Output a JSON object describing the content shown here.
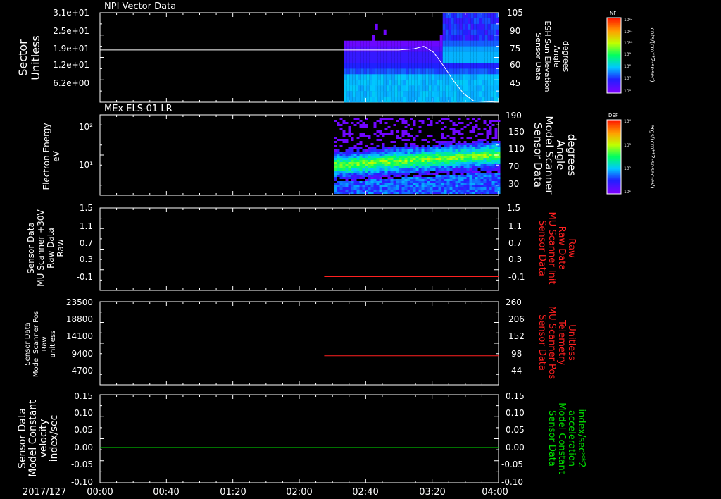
{
  "date_label": "2017/127",
  "time_ticks": [
    "00:00",
    "00:40",
    "01:20",
    "02:00",
    "02:40",
    "03:20",
    "04:00"
  ],
  "panels": [
    {
      "id": "npi",
      "title": "NPI Vector Data",
      "left_label": [
        "Sector",
        "Unitless"
      ],
      "left_ticks": [
        "3.1e+01",
        "2.5e+01",
        "1.9e+01",
        "1.2e+01",
        "6.2e+00"
      ],
      "right_label": [
        "Sensor Data",
        "ESH Sun Elevation",
        "Angle",
        "degrees"
      ],
      "right_ticks": [
        "105",
        "90",
        "75",
        "60",
        "45"
      ],
      "colorbar": {
        "tag": "NF",
        "unit": "cnts/(cm**2-sr-sec)",
        "ticks": [
          "10¹²",
          "10¹¹",
          "10¹⁰",
          "10⁹",
          "10⁸",
          "10⁷",
          "10⁶"
        ]
      }
    },
    {
      "id": "els",
      "title": "MEx ELS-01 LR",
      "left_label": [
        "Electron Energy",
        "eV"
      ],
      "left_ticks": [
        "10²",
        "10¹"
      ],
      "right_label": [
        "Sensor Data",
        "Model Scanner",
        "Angle",
        "degrees"
      ],
      "right_ticks": [
        "190",
        "150",
        "110",
        "70",
        "30"
      ],
      "colorbar": {
        "tag": "DEF",
        "unit": "ergs/(cm**2-sr-sec-eV)",
        "ticks": [
          "10⁴",
          "10³",
          "10²",
          "10¹"
        ]
      }
    },
    {
      "id": "mu30",
      "left_label": [
        "Sensor Data",
        "MU Scanner +30V",
        "Raw Data",
        "Raw"
      ],
      "left_ticks": [
        "1.5",
        "1.1",
        "0.7",
        "0.3",
        "-0.1"
      ],
      "right_label": [
        "Sensor Data",
        "MU Scanner Init",
        "Raw Data",
        "Raw"
      ],
      "right_ticks": [
        "1.5",
        "1.1",
        "0.7",
        "0.3",
        "-0.1"
      ]
    },
    {
      "id": "pos",
      "left_label": [
        "Sensor Data",
        "Model Scanner Pos",
        "Raw",
        "unitless"
      ],
      "left_ticks": [
        "23500",
        "18800",
        "14100",
        "9400",
        "4700"
      ],
      "right_label": [
        "Sensor Data",
        "MU Scanner Pos",
        "Telemetry",
        "Unitless"
      ],
      "right_ticks": [
        "260",
        "206",
        "152",
        "98",
        "44"
      ]
    },
    {
      "id": "model",
      "left_label": [
        "Sensor Data",
        "Model Constant",
        "velocity",
        "index/sec"
      ],
      "left_ticks": [
        "0.15",
        "0.10",
        "0.05",
        "0.00",
        "-0.05",
        "-0.10"
      ],
      "right_label": [
        "Sensor Data",
        "Model Constant",
        "acceleration",
        "index/sec**2"
      ],
      "right_ticks": [
        "0.15",
        "0.10",
        "0.05",
        "0.00",
        "-0.05",
        "-0.10"
      ]
    }
  ],
  "colors": {
    "white": "#ffffff",
    "red": "#ff2020",
    "green": "#00e000"
  },
  "chart_data": [
    {
      "type": "heatmap",
      "title": "NPI Vector Data",
      "x_range_hours": [
        0,
        4
      ],
      "ylabel": "Sector Unitless",
      "y2label": "Sensor Data ESH Sun Elevation Angle degrees",
      "data_start_hour": 2.45,
      "overlay_line": {
        "name": "ESH Sun Elevation Angle",
        "x": [
          0.0,
          2.45,
          3.0,
          3.15,
          3.25,
          3.35,
          3.45,
          3.55,
          3.65,
          3.75,
          4.0
        ],
        "y": [
          75,
          75,
          75,
          76,
          78,
          73,
          62,
          50,
          40,
          34,
          33
        ]
      }
    },
    {
      "type": "heatmap",
      "title": "MEx ELS-01 LR",
      "x_range_hours": [
        0,
        4
      ],
      "ylabel": "Electron Energy eV",
      "y2label": "Sensor Data Model Scanner Angle degrees",
      "data_start_hour": 2.35,
      "overlay_line": {
        "name": "Model Scanner Angle",
        "x": [
          0,
          4
        ],
        "y": [
          10,
          10
        ]
      }
    },
    {
      "type": "line",
      "x_range_hours": [
        0,
        4
      ],
      "ylim": [
        -0.3,
        1.5
      ],
      "series": [
        {
          "name": "MU Scanner Init Raw Data",
          "color": "#ff2020",
          "x": [
            2.25,
            4.0
          ],
          "y": [
            0.0,
            0.0
          ]
        }
      ]
    },
    {
      "type": "line",
      "x_range_hours": [
        0,
        4
      ],
      "ylim": [
        0,
        23500
      ],
      "series": [
        {
          "name": "MU Scanner Pos Telemetry",
          "color": "#ff2020",
          "x": [
            2.25,
            4.0
          ],
          "y": [
            8200,
            8200
          ]
        }
      ]
    },
    {
      "type": "line",
      "x_range_hours": [
        0,
        4
      ],
      "ylim": [
        -0.1,
        0.15
      ],
      "series": [
        {
          "name": "Model Constant velocity",
          "color": "#00e000",
          "x": [
            0.0,
            4.0
          ],
          "y": [
            0.0,
            0.0
          ]
        }
      ]
    }
  ]
}
